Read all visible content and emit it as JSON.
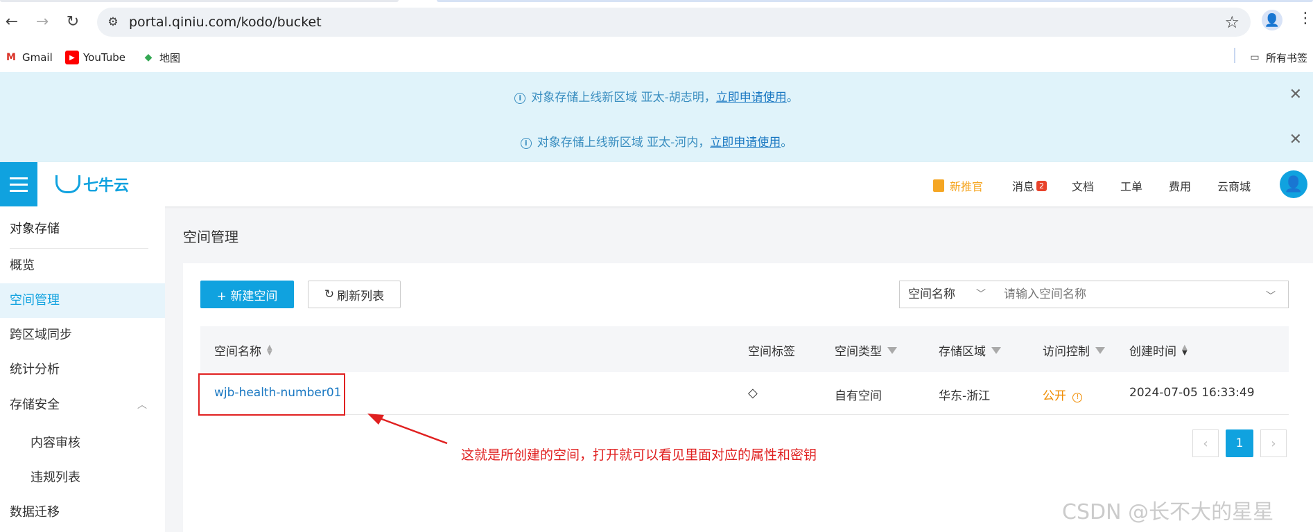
{
  "browser": {
    "url": "portal.qiniu.com/kodo/bucket",
    "bookmarks": [
      {
        "label": "Gmail",
        "icon": "gmail-icon",
        "color": "#d93025"
      },
      {
        "label": "YouTube",
        "icon": "youtube-icon",
        "color": "#ff0000"
      },
      {
        "label": "地图",
        "icon": "maps-icon",
        "color": "#34a853"
      }
    ],
    "all_bookmarks": "所有书签"
  },
  "notices": [
    {
      "text": "对象存储上线新区域 亚太-胡志明，",
      "link": "立即申请使用",
      "suffix": "。"
    },
    {
      "text": "对象存储上线新区域 亚太-河内，",
      "link": "立即申请使用",
      "suffix": "。"
    }
  ],
  "header": {
    "logo_text": "七牛云",
    "new_feature": "新推官",
    "messages": "消息",
    "messages_count": "2",
    "docs": "文档",
    "tickets": "工单",
    "billing": "费用",
    "market": "云商城",
    "accent": "#10a2df"
  },
  "sidebar": {
    "title": "对象存储",
    "items": [
      {
        "label": "概览"
      },
      {
        "label": "空间管理"
      },
      {
        "label": "跨区域同步"
      },
      {
        "label": "统计分析"
      },
      {
        "label": "存储安全"
      },
      {
        "label": "内容审核"
      },
      {
        "label": "违规列表"
      },
      {
        "label": "数据迁移"
      }
    ]
  },
  "main": {
    "page_title": "空间管理",
    "new_bucket_button": "+ 新建空间",
    "refresh_button": "刷新列表",
    "search_field": "空间名称",
    "search_placeholder": "请输入空间名称",
    "columns": [
      "空间名称",
      "空间标签",
      "空间类型",
      "存储区域",
      "访问控制",
      "创建时间"
    ],
    "rows": [
      {
        "name": "wjb-health-number01",
        "type": "自有空间",
        "region": "华东-浙江",
        "access": "公开",
        "created": "2024-07-05 16:33:49"
      }
    ],
    "pagination": {
      "current": "1"
    }
  },
  "annotation": "这就是所创建的空间，打开就可以看见里面对应的属性和密钥",
  "watermark": "CSDN @长不大的星星"
}
